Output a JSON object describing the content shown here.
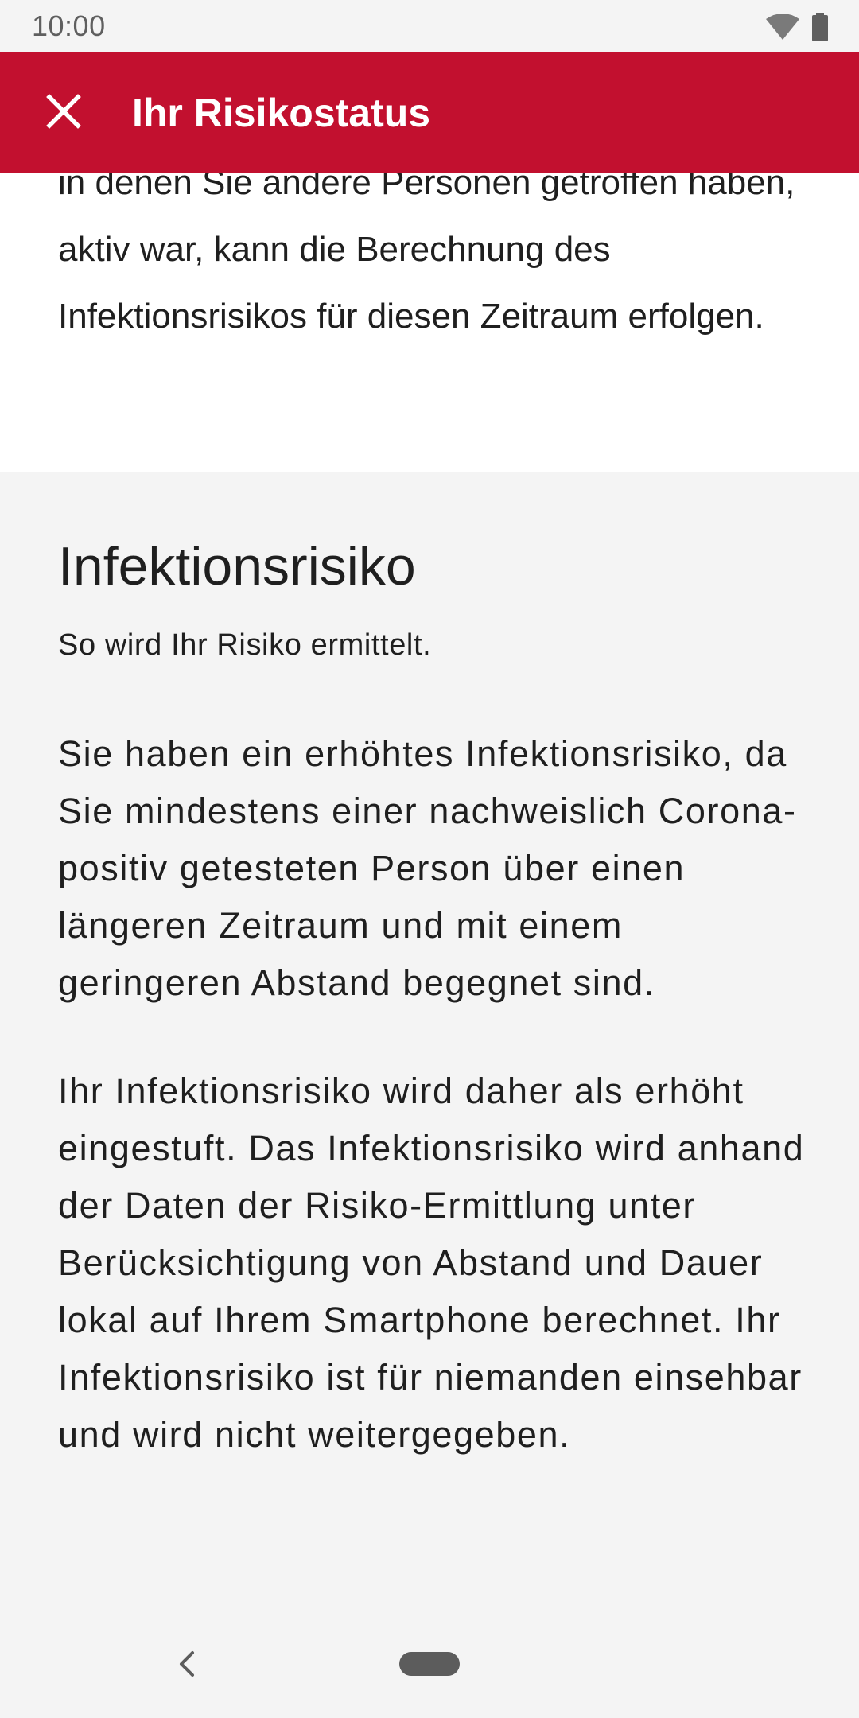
{
  "status_bar": {
    "time": "10:00",
    "icons": [
      "wifi-icon",
      "battery-icon"
    ]
  },
  "toolbar": {
    "close_icon": "close-icon",
    "title": "Ihr Risikostatus",
    "background_color": "#c2102f"
  },
  "intro": {
    "text": "in denen Sie andere Personen getroffen haben, aktiv war, kann die Berechnung des Infektionsrisikos für diesen Zeitraum erfolgen."
  },
  "infection_risk": {
    "title": "Infektionsrisiko",
    "subtitle": "So wird Ihr Risiko ermittelt.",
    "paragraph_1": "Sie haben ein erhöhtes Infektionsrisiko, da Sie mindestens einer nachweislich Corona-positiv getesteten Person über einen längeren Zeitraum und mit einem geringeren Abstand begegnet sind.",
    "paragraph_2": "Ihr Infektionsrisiko wird daher als erhöht eingestuft. Das Infektionsrisiko wird anhand der Daten der Risiko-Ermittlung unter Berücksichtigung von Abstand und Dauer lokal auf Ihrem Smartphone berechnet. Ihr Infektionsrisiko ist für niemanden einsehbar und wird nicht weitergegeben."
  },
  "nav_bar": {
    "icons": [
      "back-icon",
      "home-pill-icon"
    ]
  }
}
